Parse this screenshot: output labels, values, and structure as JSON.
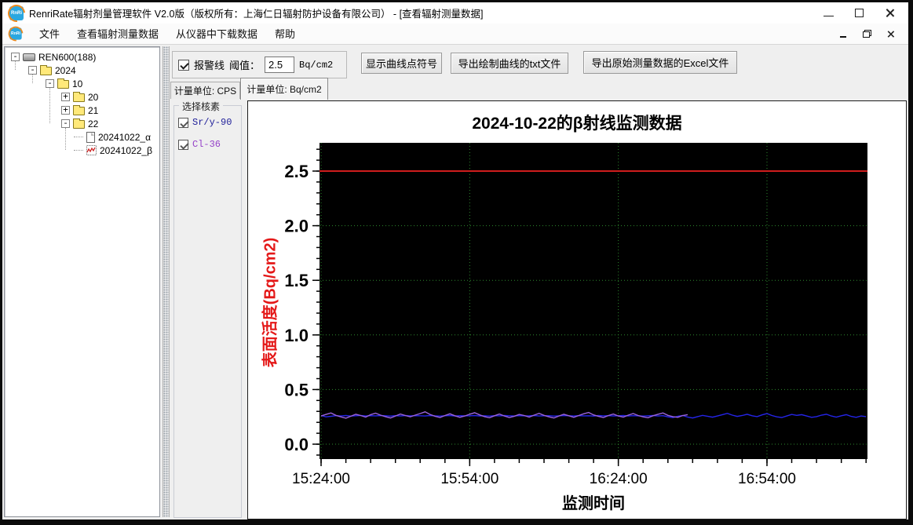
{
  "window": {
    "title": "RenriRate辐射剂量管理软件 V2.0版（版权所有：上海仁日辐射防护设备有限公司） - [查看辐射测量数据]"
  },
  "menu": {
    "items": [
      "文件",
      "查看辐射测量数据",
      "从仪器中下载数据",
      "帮助"
    ]
  },
  "tree": {
    "items": [
      {
        "label": "REN600(188)",
        "level": 0,
        "expander": "-",
        "icon": "device"
      },
      {
        "label": "2024",
        "level": 1,
        "expander": "-",
        "icon": "folder"
      },
      {
        "label": "10",
        "level": 2,
        "expander": "-",
        "icon": "folder"
      },
      {
        "label": "20",
        "level": 3,
        "expander": "+",
        "icon": "folder"
      },
      {
        "label": "21",
        "level": 3,
        "expander": "+",
        "icon": "folder"
      },
      {
        "label": "22",
        "level": 3,
        "expander": "-",
        "icon": "folder"
      },
      {
        "label": "20241022_α",
        "level": 4,
        "expander": null,
        "icon": "doc"
      },
      {
        "label": "20241022_β",
        "level": 4,
        "expander": null,
        "icon": "chart"
      }
    ]
  },
  "toolbar": {
    "alarm_label": "报警线",
    "alarm_checked": true,
    "threshold_label": "阈值：",
    "threshold_value": "2.5",
    "threshold_unit": "Bq/cm2",
    "btn_show_points": "显示曲线点符号",
    "btn_export_txt": "导出绘制曲线的txt文件",
    "btn_export_excel": "导出原始测量数据的Excel文件"
  },
  "tabs": [
    {
      "label": "计量单位: CPS",
      "active": false
    },
    {
      "label": "计量单位: Bq/cm2",
      "active": true
    }
  ],
  "nuclide_panel": {
    "title": "选择核素",
    "items": [
      {
        "label": "Sr/y-90",
        "checked": true,
        "color": "#20209a"
      },
      {
        "label": "Cl-36",
        "checked": true,
        "color": "#9440c8"
      }
    ]
  },
  "chart_data": {
    "type": "line",
    "title": "2024-10-22的β射线监测数据",
    "xlabel": "监测时间",
    "ylabel": "表面活度(Bq/cm2)",
    "plot_bg": "#000000",
    "ylim": [
      -0.14,
      2.76
    ],
    "y_ticks": [
      0.0,
      0.5,
      1.0,
      1.5,
      2.0,
      2.5
    ],
    "y_minor_step": 0.1,
    "x_ticks": [
      {
        "label": "15:24:00",
        "min": 0
      },
      {
        "label": "15:54:00",
        "min": 30
      },
      {
        "label": "16:24:00",
        "min": 60
      },
      {
        "label": "16:54:00",
        "min": 90
      }
    ],
    "x_minor_step_min": 5,
    "x_range_min": [
      0,
      110
    ],
    "alarm_line": {
      "value": 2.5,
      "color": "#cf1d1d"
    },
    "grid": {
      "color": "#2e8b2e",
      "style": "dotted"
    },
    "series": [
      {
        "name": "Sr/y-90",
        "color": "#2424e8",
        "step_min": 1,
        "values": [
          0.262,
          0.25,
          0.255,
          0.261,
          0.258,
          0.262,
          0.257,
          0.26,
          0.263,
          0.258,
          0.261,
          0.259,
          0.262,
          0.26,
          0.257,
          0.261,
          0.258,
          0.262,
          0.259,
          0.261,
          0.26,
          0.258,
          0.262,
          0.259,
          0.257,
          0.26,
          0.262,
          0.258,
          0.261,
          0.259,
          0.26,
          0.262,
          0.258,
          0.26,
          0.257,
          0.261,
          0.259,
          0.262,
          0.26,
          0.258,
          0.261,
          0.259,
          0.26,
          0.262,
          0.258,
          0.26,
          0.261,
          0.257,
          0.259,
          0.262,
          0.26,
          0.258,
          0.261,
          0.259,
          0.26,
          0.257,
          0.262,
          0.259,
          0.261,
          0.258,
          0.26,
          0.262,
          0.258,
          0.261,
          0.259,
          0.257,
          0.26,
          0.262,
          0.258,
          0.261,
          0.25,
          0.243,
          0.256,
          0.262,
          0.248,
          0.24,
          0.252,
          0.264,
          0.256,
          0.247,
          0.258,
          0.27,
          0.282,
          0.266,
          0.254,
          0.262,
          0.274,
          0.26,
          0.252,
          0.268,
          0.28,
          0.262,
          0.25,
          0.244,
          0.258,
          0.272,
          0.264,
          0.27,
          0.258,
          0.246,
          0.252,
          0.266,
          0.274,
          0.258,
          0.248,
          0.26,
          0.27,
          0.254,
          0.246,
          0.258,
          0.252
        ]
      },
      {
        "name": "Cl-36",
        "color": "#9b64dc",
        "step_min": 1,
        "values": [
          0.258,
          0.272,
          0.286,
          0.264,
          0.25,
          0.238,
          0.256,
          0.274,
          0.262,
          0.248,
          0.27,
          0.284,
          0.266,
          0.252,
          0.24,
          0.258,
          0.276,
          0.262,
          0.25,
          0.266,
          0.28,
          0.296,
          0.272,
          0.256,
          0.244,
          0.262,
          0.278,
          0.26,
          0.246,
          0.258,
          0.274,
          0.288,
          0.268,
          0.252,
          0.242,
          0.26,
          0.276,
          0.258,
          0.244,
          0.256,
          0.272,
          0.262,
          0.248,
          0.266,
          0.282,
          0.264,
          0.25,
          0.24,
          0.258,
          0.274,
          0.26,
          0.246,
          0.262,
          0.278,
          0.29,
          0.268,
          0.254,
          0.244,
          0.262,
          0.276,
          0.258,
          0.248,
          0.266,
          0.28,
          0.262,
          0.25,
          0.242,
          0.26,
          0.274,
          0.286,
          0.264,
          0.252,
          0.246,
          0.262,
          0.27
        ]
      }
    ]
  }
}
